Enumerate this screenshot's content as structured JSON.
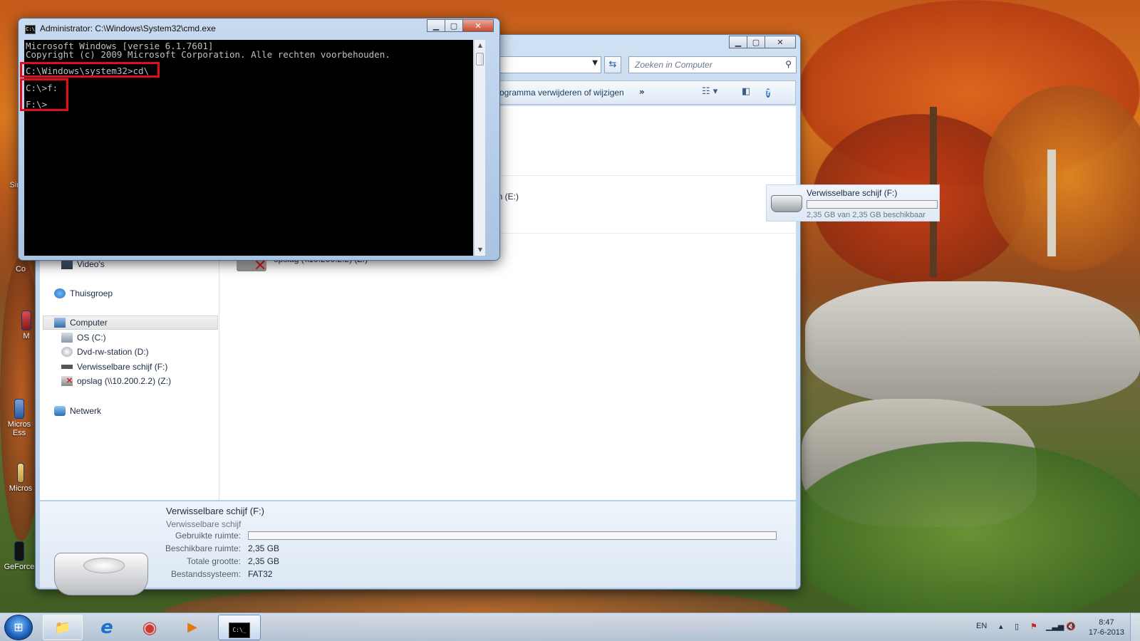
{
  "desktop": {
    "icons": [
      {
        "label": "Sim",
        "icon": "app-icon"
      },
      {
        "label": "Co",
        "icon": "computer-icon"
      },
      {
        "label": "M",
        "icon": "shield-app-icon"
      },
      {
        "label": "Micros Ess",
        "icon": "security-essentials-icon"
      },
      {
        "label": "Micros",
        "icon": "folder-icon"
      },
      {
        "label": "GeForce",
        "icon": "nvidia-icon"
      }
    ]
  },
  "cmd": {
    "title": "Administrator: C:\\Windows\\System32\\cmd.exe",
    "lines": [
      "Microsoft Windows [versie 6.1.7601]",
      "Copyright (c) 2009 Microsoft Corporation. Alle rechten voorbehouden.",
      "C:\\Windows\\system32>cd\\",
      "C:\\>f:",
      "F:\\>"
    ],
    "highlight_color": "#e00d1b"
  },
  "explorer": {
    "search_placeholder": "Zoeken in Computer",
    "command_bar": {
      "uninstall_label": "rogramma verwijderen of wijzigen",
      "more_label": "»",
      "help_label": "?"
    },
    "nav": {
      "videos": "Video's",
      "homegroup": "Thuisgroep",
      "computer": "Computer",
      "drive_c": "OS (C:)",
      "drive_d": "Dvd-rw-station (D:)",
      "drive_f": "Verwisselbare schijf (F:)",
      "drive_z": "opslag (\\\\10.200.2.2) (Z:)",
      "network": "Netwerk"
    },
    "content": {
      "drive_e_partial": "on (E:)",
      "drive_f_tile": {
        "title": "Verwisselbare schijf (F:)",
        "subtitle": "2,35 GB van 2,35 GB beschikbaar",
        "used_fraction": 0.0
      },
      "net_drive_label": "opslag (\\\\10.200.2.2) (Z:)"
    },
    "details": {
      "title": "Verwisselbare schijf (F:)",
      "type": "Verwisselbare schijf",
      "used_label": "Gebruikte ruimte:",
      "used_fraction": 0.0,
      "free_label": "Beschikbare ruimte:",
      "free_value": "2,35 GB",
      "total_label": "Totale grootte:",
      "total_value": "2,35 GB",
      "fs_label": "Bestandssysteem:",
      "fs_value": "FAT32"
    }
  },
  "taskbar": {
    "start_label": "⊞",
    "apps": [
      {
        "name": "explorer",
        "glyph": "📁"
      },
      {
        "name": "internet-explorer",
        "glyph": "e"
      },
      {
        "name": "chrome",
        "glyph": "◉"
      },
      {
        "name": "media-player",
        "glyph": "▶"
      },
      {
        "name": "cmd",
        "glyph": "C:\\_"
      }
    ],
    "language": "EN",
    "time": "8:47",
    "date": "17-6-2013"
  }
}
